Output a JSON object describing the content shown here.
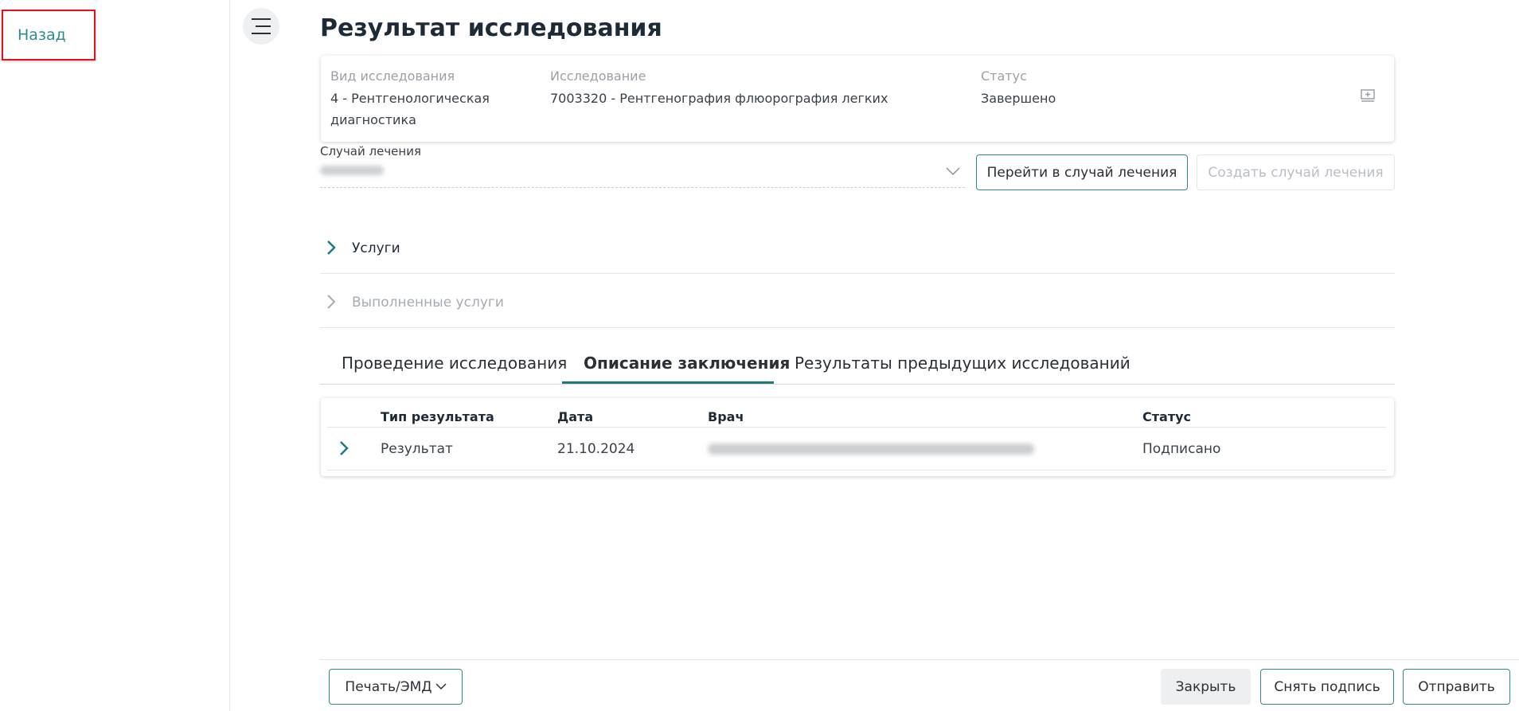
{
  "sidebar": {
    "back_label": "Назад"
  },
  "page": {
    "title": "Результат исследования"
  },
  "info_card": {
    "study_type_label": "Вид исследования",
    "study_type_value_line1": "4 - Рентгенологическая",
    "study_type_value_line2": "диагностика",
    "study_label": "Исследование",
    "study_value": "7003320 - Рентгенография флюорография легких",
    "status_label": "Статус",
    "status_value": "Завершено"
  },
  "treatment_case": {
    "label": "Случай лечения",
    "goto_button": "Перейти в случай лечения",
    "create_button": "Создать случай лечения"
  },
  "sections": [
    {
      "title": "Услуги"
    },
    {
      "title": "Выполненные услуги"
    }
  ],
  "tabs": [
    {
      "label": "Проведение исследования"
    },
    {
      "label": "Описание заключения"
    },
    {
      "label": "Результаты предыдущих исследований"
    }
  ],
  "active_tab": "Описание заключения",
  "results_table": {
    "headers": [
      "Тип результата",
      "Дата",
      "Врач",
      "Статус"
    ],
    "rows": [
      {
        "type": "Результат",
        "date": "21.10.2024",
        "doctor": "",
        "status": "Подписано"
      }
    ]
  },
  "footer": {
    "print_button": "Печать/ЭМД",
    "close_button": "Закрыть",
    "unsign_button": "Снять подпись",
    "send_button": "Отправить"
  },
  "colors": {
    "accent": "#2e8b8b",
    "tab_underline": "#1f7a7a",
    "highlight_border": "#e0141e"
  },
  "icons": [
    "menu-icon",
    "card-detail-icon",
    "chevron-down-icon",
    "chevron-right-icon"
  ]
}
